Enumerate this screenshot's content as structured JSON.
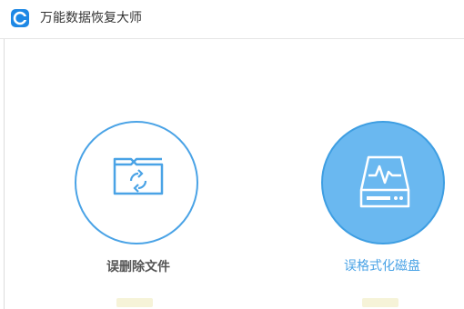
{
  "app": {
    "title": "万能数据恢复大师",
    "logo_icon": "recover-logo-icon",
    "accent": "#1e88e5"
  },
  "options": [
    {
      "label": "误删除文件",
      "icon": "folder-recycle-icon",
      "selected": false,
      "label_color": "#555555"
    },
    {
      "label": "误格式化磁盘",
      "icon": "hard-drive-pulse-icon",
      "selected": true,
      "label_color": "#4aa3e6",
      "fill": "#6ab8f0"
    }
  ]
}
